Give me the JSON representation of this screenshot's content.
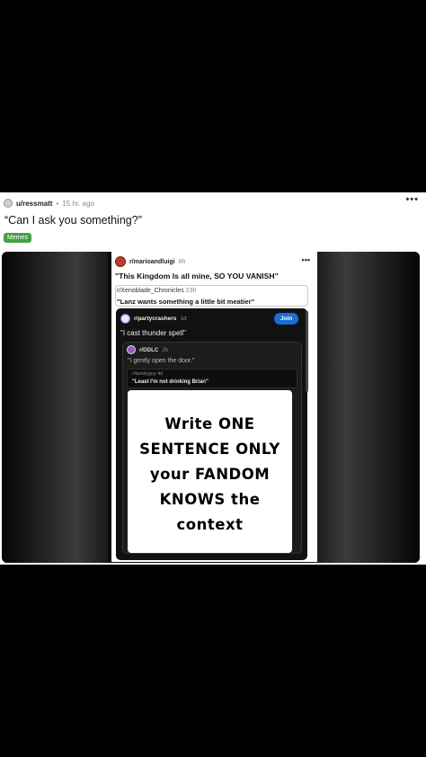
{
  "post": {
    "username": "u/ressmatt",
    "separator": "•",
    "time": "15 hr. ago",
    "more": "•••",
    "title": "“Can I ask you something?”",
    "flair": "Memes",
    "flair_color": "#46a047"
  },
  "screenshot": {
    "outer": {
      "subreddit": "r/marioandluigi",
      "time": "8h",
      "more": "•••",
      "title": "\"This Kingdom Is all mine, SO YOU VANISH\""
    },
    "quote1": {
      "subreddit": "r/Xenoblade_Chronicles",
      "time": "23h",
      "title": "\"Lanz wants something a little bit meatier\""
    },
    "inner": {
      "subreddit": "r/partycrashers",
      "time": "1d",
      "join_label": "Join",
      "join_color": "#1a6fd6",
      "title": "\"I cast thunder spell\""
    },
    "inner2": {
      "subreddit": "r/DDLC",
      "time": "2h",
      "title": "\"I gently open the door.\""
    },
    "quote2": {
      "subreddit": "r/familyguy",
      "time": "4d",
      "title": "\"Least I'm not drinking Brian\""
    },
    "prompt_text": "Write ONE\nSENTENCE ONLY\nyour FANDOM\nKNOWS the\ncontext"
  }
}
